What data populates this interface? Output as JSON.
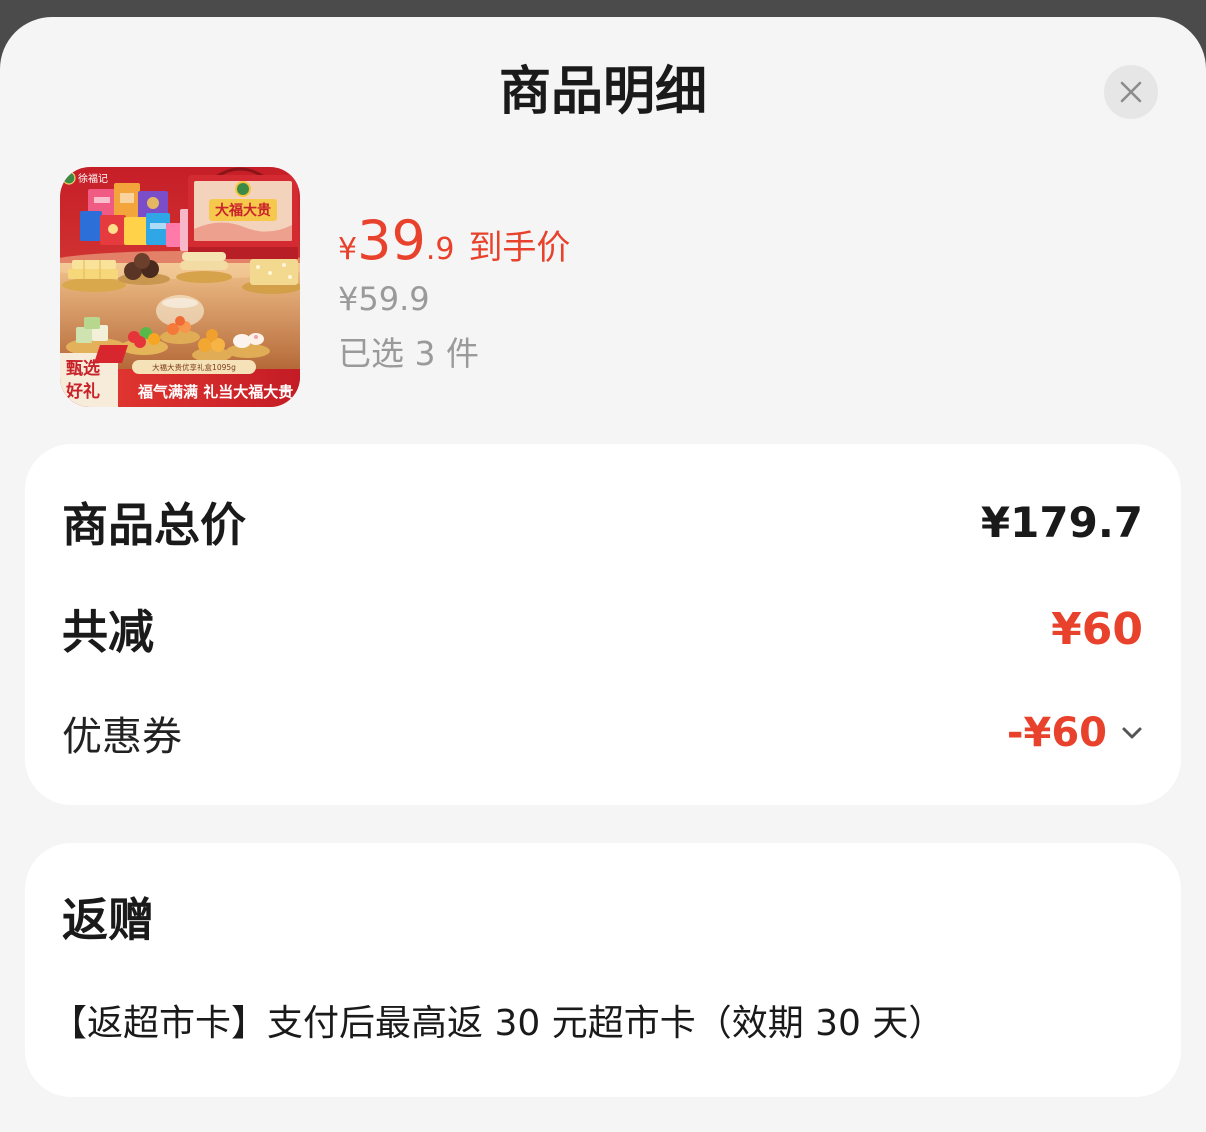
{
  "theme": {
    "overlay": "#4b4b4b",
    "sheet_bg": "#f5f5f5",
    "card_bg": "#ffffff",
    "text": "#1a1a1a",
    "muted": "#9a9a9a",
    "accent": "#e8412c",
    "icon": "#8c8c8c"
  },
  "sheet": {
    "title": "商品明细",
    "close_button": {
      "icon": "close-icon"
    }
  },
  "product": {
    "image": {
      "brand": "徐福记",
      "box_title": "大福大贵",
      "badge_lines": [
        "甄选",
        "好礼"
      ],
      "pack_label": "大福大贵优享礼盒1095g",
      "banner": "福气满满 礼当大福大贵"
    },
    "price": {
      "currency": "¥",
      "integer": "39",
      "decimal": ".9",
      "label": "到手价"
    },
    "original_price": "¥59.9",
    "selected_count": "已选 3 件"
  },
  "summary": {
    "total": {
      "label": "商品总价",
      "value": "¥179.7"
    },
    "discount": {
      "label": "共减",
      "value": "¥60"
    },
    "coupon": {
      "label": "优惠券",
      "value": "-¥60",
      "icon": "chevron-down-icon"
    }
  },
  "rebate": {
    "title": "返赠",
    "text": "【返超市卡】支付后最高返 30 元超市卡（效期 30 天）"
  }
}
